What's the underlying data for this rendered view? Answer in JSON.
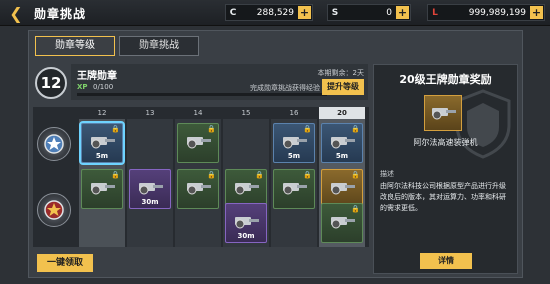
{
  "header": {
    "title": "勋章挑战",
    "currencies": [
      {
        "icon": "C",
        "value": "288,529",
        "color": "#ffffff"
      },
      {
        "icon": "S",
        "value": "0",
        "color": "#ffffff"
      },
      {
        "icon": "L",
        "value": "999,989,199",
        "color": "#e0443a"
      }
    ],
    "plus": "+"
  },
  "tabs": [
    {
      "label": "勋章等级"
    },
    {
      "label": "勋章挑战"
    }
  ],
  "level": {
    "number": "12",
    "name": "王牌勋章",
    "season_label": "本期剩余：2天",
    "xp_label": "XP",
    "xp_value": "0/100",
    "xp_progress": 0,
    "hint": "完成勋章挑战获得经验",
    "upgrade_label": "提升等级"
  },
  "grid": {
    "columns": [
      "12",
      "13",
      "14",
      "15",
      "16",
      "20"
    ],
    "cells": [
      {
        "row": 0,
        "col": 0,
        "color": "blue",
        "label": "5m",
        "selected": true,
        "locked": true
      },
      {
        "row": 0,
        "col": 2,
        "color": "green",
        "label": "",
        "locked": true
      },
      {
        "row": 0,
        "col": 4,
        "color": "blue",
        "label": "5m",
        "locked": true
      },
      {
        "row": 0,
        "col": 5,
        "color": "blue",
        "label": "5m",
        "locked": true
      },
      {
        "row": 1,
        "col": 0,
        "color": "green",
        "label": "",
        "locked": true
      },
      {
        "row": 1,
        "col": 1,
        "color": "purple",
        "label": "30m",
        "locked": false
      },
      {
        "row": 1,
        "col": 2,
        "color": "green",
        "label": "",
        "locked": true
      },
      {
        "row": 1,
        "col": 3,
        "color": "green",
        "label": "",
        "locked": true
      },
      {
        "row": 1,
        "col": 4,
        "color": "green",
        "label": "",
        "locked": true
      },
      {
        "row": 1,
        "col": 5,
        "color": "orange",
        "label": "",
        "locked": true
      },
      {
        "row": 2,
        "col": 3,
        "color": "purple",
        "label": "30m",
        "locked": false
      },
      {
        "row": 2,
        "col": 5,
        "color": "green",
        "label": "",
        "locked": true
      }
    ]
  },
  "claim_label": "一键领取",
  "reward": {
    "title": "20级王牌勋章奖励",
    "item_name": "阿尔法高速装弹机",
    "desc_title": "描述",
    "description": "由阿尔法科技公司根据原型产品进行升级改良后的版本，其对运算力、功率和科研的需求更低。",
    "detail_label": "详情"
  }
}
